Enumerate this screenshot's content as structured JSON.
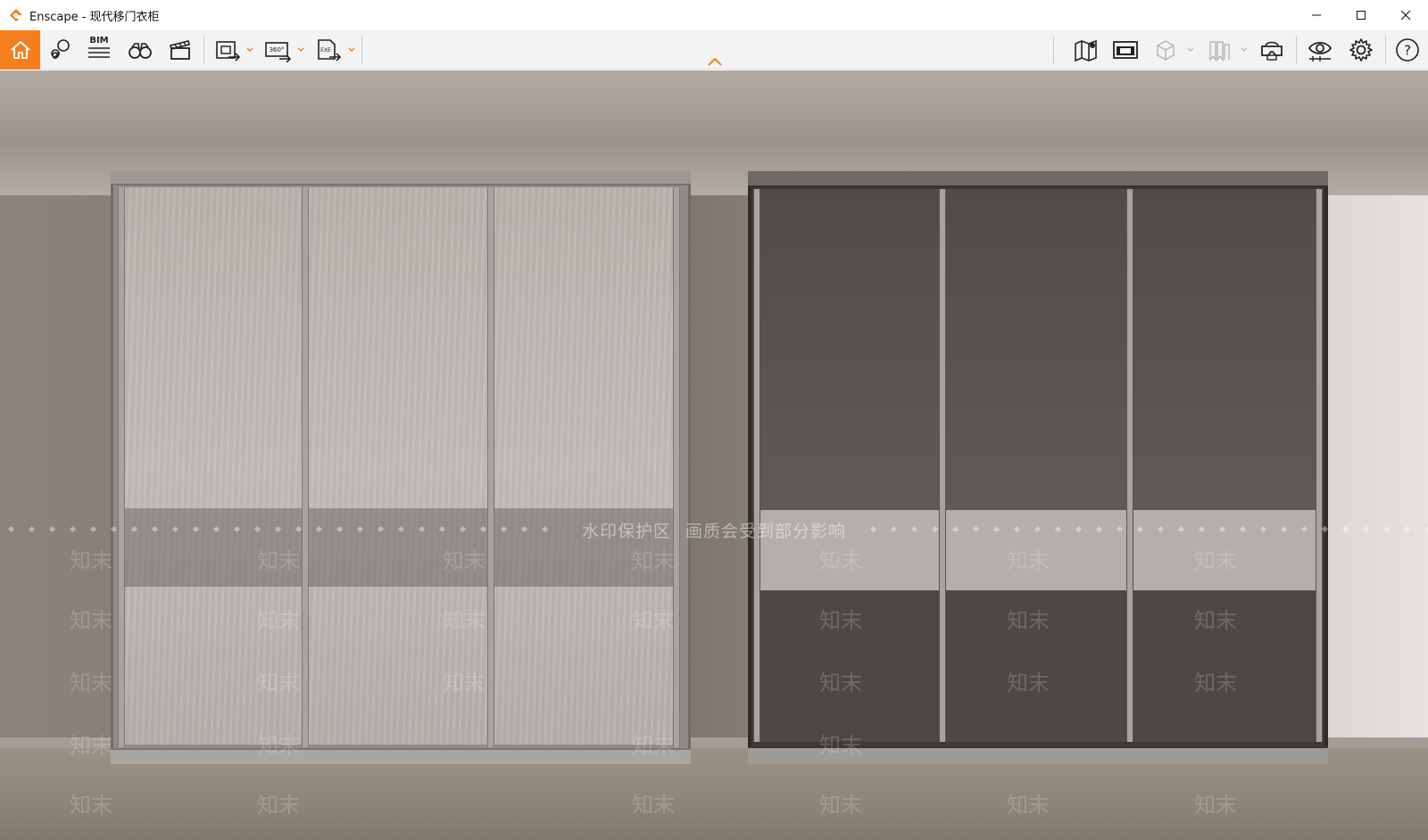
{
  "window": {
    "title": "Enscape - 现代移门衣柜",
    "controls": {
      "minimize": "minimize-icon",
      "maximize": "maximize-icon",
      "close": "close-icon"
    }
  },
  "toolbar": {
    "left_tools": [
      {
        "name": "home",
        "icon": "home-icon",
        "label": ""
      },
      {
        "name": "views",
        "icon": "map-pin-icon",
        "label": ""
      },
      {
        "name": "bim",
        "icon": "bim-icon",
        "label": "BIM"
      },
      {
        "name": "fly-mode",
        "icon": "binoculars-icon",
        "label": ""
      },
      {
        "name": "video",
        "icon": "clapperboard-icon",
        "label": ""
      }
    ],
    "export_tools": [
      {
        "name": "render-image",
        "icon": "export-image-icon",
        "label": ""
      },
      {
        "name": "render-panorama",
        "icon": "export-panorama-icon",
        "label": "360°"
      },
      {
        "name": "export-exe",
        "icon": "export-exe-icon",
        "label": "EXE"
      }
    ],
    "right_tools": [
      {
        "name": "map",
        "icon": "map-icon",
        "label": ""
      },
      {
        "name": "assets",
        "icon": "asset-library-icon",
        "label": ""
      },
      {
        "name": "box",
        "icon": "cube-icon",
        "label": ""
      },
      {
        "name": "bookmarks",
        "icon": "bookmark-icon",
        "label": ""
      },
      {
        "name": "vr",
        "icon": "vr-headset-icon",
        "label": ""
      },
      {
        "name": "visual-settings",
        "icon": "eye-icon",
        "label": ""
      },
      {
        "name": "settings",
        "icon": "gear-icon",
        "label": ""
      },
      {
        "name": "help",
        "icon": "help-icon",
        "label": "?"
      }
    ]
  },
  "viewport": {
    "watermark_left": "水印保护区",
    "watermark_right": "画质会受到部分影响",
    "watermark_tile": "知末"
  },
  "colors": {
    "accent": "#f57e1e"
  }
}
